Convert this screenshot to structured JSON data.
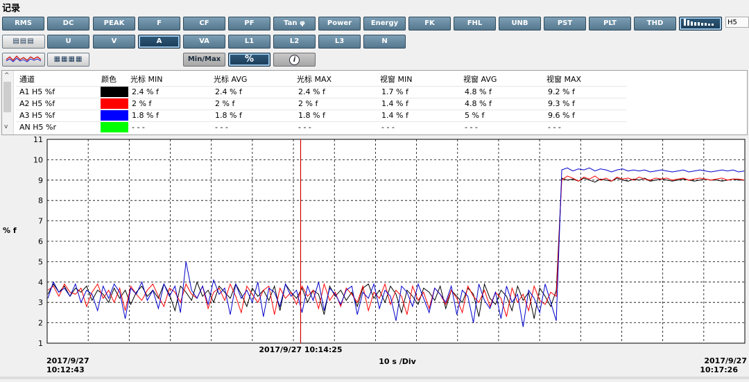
{
  "title": "记录",
  "toolbar_row1": [
    "RMS",
    "DC",
    "PEAK",
    "F",
    "CF",
    "PF",
    "Tan φ",
    "Power",
    "Energy",
    "FK",
    "FHL",
    "UNB",
    "PST",
    "PLT",
    "THD"
  ],
  "toolbar_row2": [
    "U",
    "V",
    "A",
    "VA",
    "L1",
    "L2",
    "L3",
    "N"
  ],
  "active_row2": "A",
  "harmonic_label": "H5",
  "minmax_label": "Min/Max",
  "percent_label": "%",
  "info_label": "i",
  "table": {
    "headers": [
      "通道",
      "颜色",
      "光标 MIN",
      "光标 AVG",
      "光标 MAX",
      "视窗 MIN",
      "视窗 AVG",
      "视窗 MAX"
    ],
    "rows": [
      {
        "ch": "A1 H5 %f",
        "color": "#000000",
        "cmin": "2.4 % f",
        "cavg": "2.4 % f",
        "cmax": "2.4 % f",
        "wmin": "1.7 % f",
        "wavg": "4.8 % f",
        "wmax": "9.2 % f"
      },
      {
        "ch": "A2 H5 %f",
        "color": "#ff0000",
        "cmin": "2 % f",
        "cavg": "2 % f",
        "cmax": "2 % f",
        "wmin": "1.4 % f",
        "wavg": "4.8 % f",
        "wmax": "9.3 % f"
      },
      {
        "ch": "A3 H5 %f",
        "color": "#0000ff",
        "cmin": "1.8 % f",
        "cavg": "1.8 % f",
        "cmax": "1.8 % f",
        "wmin": "1.4 % f",
        "wavg": "5 % f",
        "wmax": "9.6 % f"
      },
      {
        "ch": "AN H5 %r",
        "color": "#00ff00",
        "cmin": "- - -",
        "cavg": "- - -",
        "cmax": "- - -",
        "wmin": "- - -",
        "wavg": "- - -",
        "wmax": "- - -"
      }
    ]
  },
  "chart_data": {
    "type": "line",
    "ylabel": "% f",
    "ylim": [
      1,
      11
    ],
    "yticks": [
      1,
      2,
      3,
      4,
      5,
      6,
      7,
      8,
      9,
      10,
      11
    ],
    "x_start_date": "2017/9/27",
    "x_start_time": "10:12:43",
    "x_end_date": "2017/9/27",
    "x_end_time": "10:17:26",
    "division_label": "10 s /Div",
    "cursor_label": "2017/9/27 10:14:25",
    "grid": true,
    "series": [
      {
        "color": "#000000",
        "values": [
          3.4,
          3.9,
          3.5,
          3.8,
          3.3,
          3.7,
          3.5,
          3.8,
          3.1,
          3.6,
          3.4,
          3.0,
          3.7,
          3.2,
          3.6,
          2.9,
          3.5,
          3.8,
          3.3,
          3.6,
          3.2,
          3.9,
          3.4,
          2.6,
          3.8,
          3.5,
          3.1,
          4.0,
          3.3,
          3.6,
          3.0,
          3.8,
          3.5,
          3.2,
          3.9,
          3.4,
          2.8,
          3.7,
          3.3,
          3.6,
          3.1,
          3.8,
          2.6,
          3.9,
          3.5,
          3.2,
          3.7,
          3.0,
          3.6,
          3.4,
          2.4,
          3.8,
          3.3,
          3.6,
          3.1,
          3.5,
          2.8,
          3.7,
          3.9,
          3.2,
          3.6,
          3.0,
          3.8,
          3.4,
          2.5,
          3.6,
          3.3,
          2.9,
          3.7,
          3.5,
          3.1,
          3.8,
          2.7,
          3.6,
          3.3,
          3.0,
          3.7,
          3.4,
          2.3,
          3.9,
          3.2,
          2.9,
          3.6,
          3.3,
          2.6,
          3.8,
          3.1,
          3.5,
          2.2,
          3.7,
          3.3,
          2.8,
          3.6,
          9.1,
          9.0,
          9.05,
          8.95,
          9.1,
          9.0,
          8.9,
          9.05,
          9.0,
          8.95,
          9.1,
          9.0,
          8.95,
          9.05,
          9.0,
          9.1,
          8.95,
          9.0,
          9.05,
          9.0,
          8.95,
          9.0,
          9.05,
          9.0,
          8.95,
          9.0,
          9.05,
          9.0,
          9.0,
          8.95,
          9.0,
          9.05,
          9.0,
          9.0
        ]
      },
      {
        "color": "#ff0000",
        "values": [
          3.6,
          3.8,
          3.3,
          3.9,
          3.5,
          3.4,
          3.7,
          2.8,
          3.5,
          3.9,
          3.2,
          3.6,
          3.0,
          3.7,
          2.6,
          3.8,
          3.4,
          3.1,
          3.6,
          3.9,
          3.3,
          2.8,
          3.7,
          3.5,
          3.0,
          3.9,
          3.4,
          3.2,
          3.8,
          2.7,
          3.5,
          3.7,
          3.1,
          3.9,
          3.3,
          2.5,
          3.8,
          3.4,
          3.0,
          3.6,
          3.8,
          2.4,
          3.7,
          3.2,
          3.5,
          2.9,
          3.8,
          3.3,
          3.6,
          2.7,
          3.9,
          3.1,
          3.5,
          2.8,
          3.7,
          3.4,
          3.0,
          3.8,
          2.6,
          3.5,
          3.2,
          3.9,
          2.9,
          3.6,
          3.3,
          2.4,
          3.8,
          3.1,
          3.5,
          2.7,
          3.7,
          3.4,
          2.9,
          3.6,
          3.2,
          2.5,
          3.8,
          3.3,
          3.0,
          3.6,
          2.8,
          3.5,
          3.2,
          2.3,
          3.7,
          3.0,
          3.4,
          2.6,
          3.8,
          3.1,
          2.9,
          3.5,
          3.3,
          9.0,
          9.2,
          9.1,
          8.95,
          9.15,
          9.05,
          9.2,
          9.0,
          9.1,
          8.95,
          9.15,
          9.05,
          9.1,
          9.0,
          9.15,
          9.05,
          9.0,
          9.1,
          9.05,
          9.1,
          9.0,
          9.05,
          9.1,
          9.0,
          9.05,
          9.1,
          9.05,
          9.0,
          9.05,
          9.1,
          9.0,
          9.05,
          9.05,
          9.0
        ]
      },
      {
        "color": "#0000cc",
        "values": [
          3.2,
          4.0,
          3.5,
          3.7,
          3.3,
          3.9,
          3.0,
          3.6,
          3.4,
          2.6,
          3.8,
          3.2,
          3.9,
          3.5,
          2.2,
          3.7,
          3.4,
          4.0,
          3.1,
          3.6,
          2.7,
          3.9,
          3.3,
          3.8,
          2.5,
          5.0,
          3.6,
          3.2,
          3.8,
          2.9,
          4.1,
          3.4,
          3.7,
          2.4,
          3.9,
          3.2,
          3.6,
          3.0,
          4.0,
          2.3,
          3.7,
          3.5,
          2.8,
          3.9,
          3.3,
          3.6,
          2.5,
          3.8,
          3.1,
          4.0,
          2.6,
          3.7,
          3.4,
          2.9,
          3.6,
          3.8,
          2.4,
          3.5,
          3.2,
          3.9,
          2.7,
          3.6,
          3.3,
          2.1,
          3.8,
          3.5,
          2.8,
          3.9,
          3.2,
          2.5,
          3.7,
          3.4,
          3.0,
          3.8,
          2.4,
          3.6,
          3.3,
          2.0,
          3.9,
          3.1,
          2.7,
          3.5,
          2.2,
          3.8,
          3.0,
          3.4,
          1.8,
          3.6,
          3.2,
          2.5,
          3.9,
          3.0,
          2.1,
          9.5,
          9.6,
          9.45,
          9.55,
          9.5,
          9.6,
          9.45,
          9.55,
          9.5,
          9.4,
          9.5,
          9.55,
          9.45,
          9.5,
          9.45,
          9.5,
          9.4,
          9.45,
          9.5,
          9.45,
          9.4,
          9.45,
          9.5,
          9.4,
          9.45,
          9.5,
          9.45,
          9.4,
          9.45,
          9.5,
          9.45,
          9.5,
          9.4,
          9.45
        ]
      }
    ]
  }
}
